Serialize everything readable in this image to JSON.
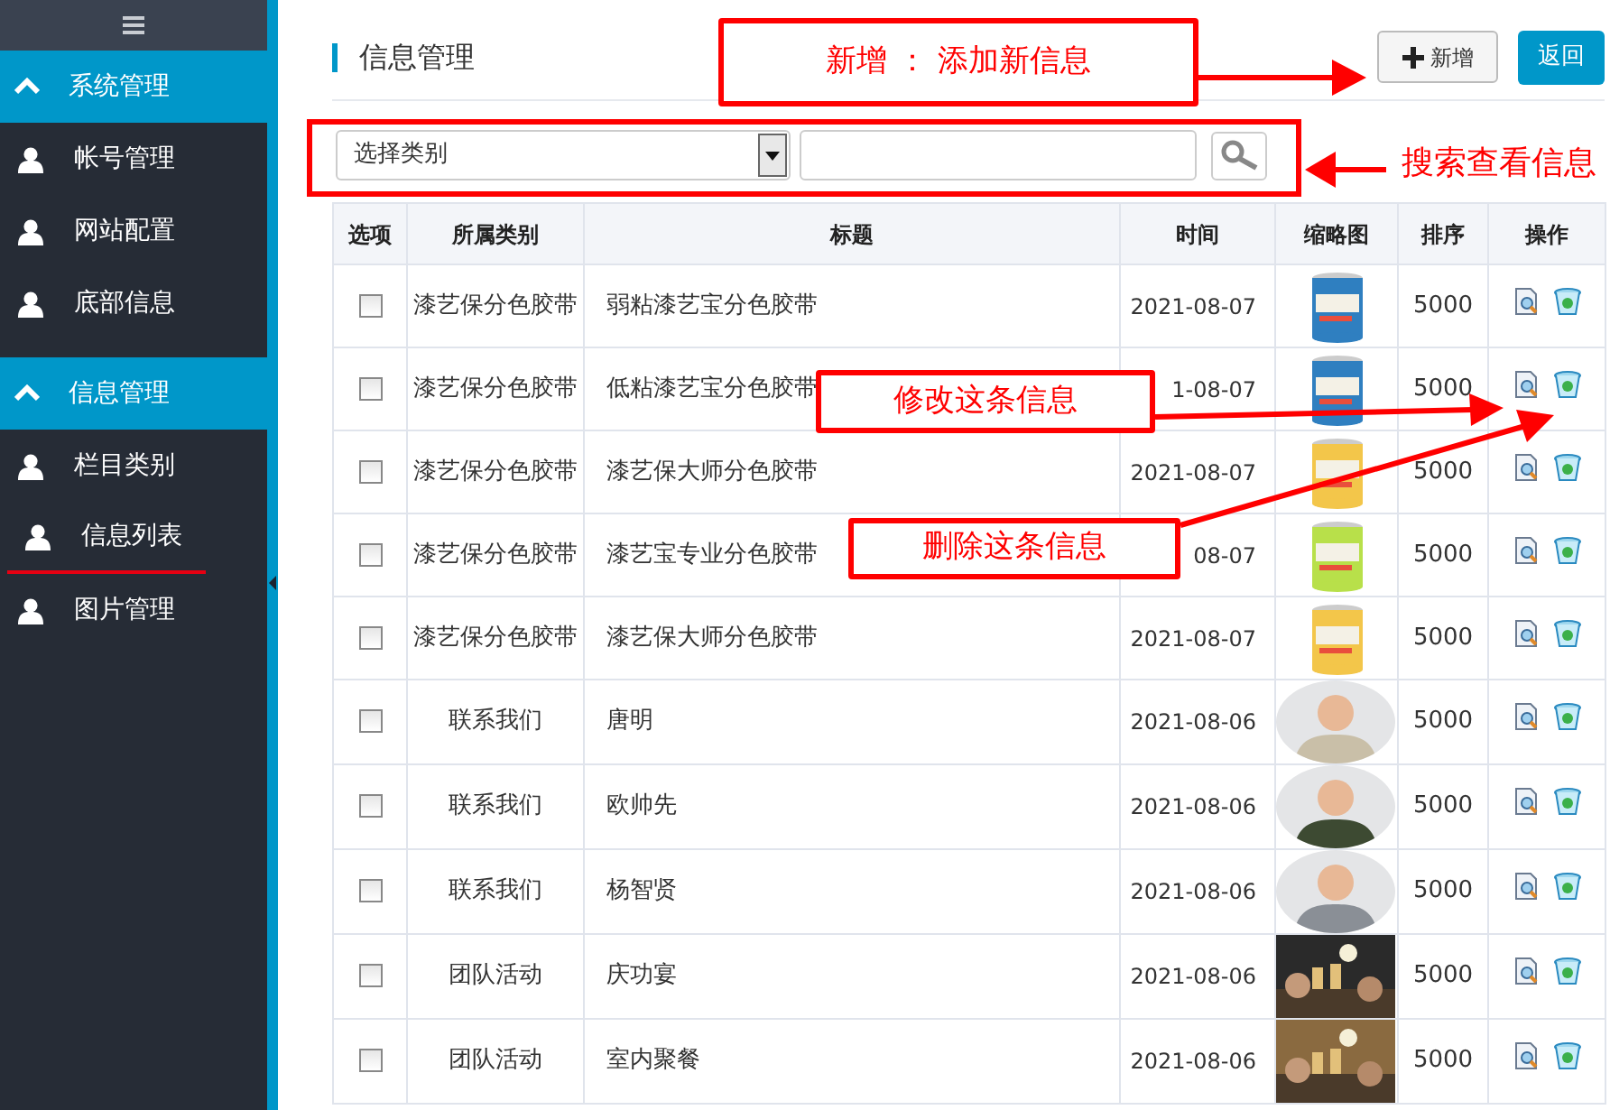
{
  "sidebar": {
    "groups": [
      {
        "title": "系统管理",
        "expanded": true,
        "items": [
          {
            "label": "帐号管理",
            "selected": false
          },
          {
            "label": "网站配置",
            "selected": false
          },
          {
            "label": "底部信息",
            "selected": false
          }
        ]
      },
      {
        "title": "信息管理",
        "expanded": true,
        "items": [
          {
            "label": "栏目类别",
            "selected": false
          },
          {
            "label": "信息列表",
            "selected": true
          },
          {
            "label": "图片管理",
            "selected": false
          }
        ]
      }
    ]
  },
  "page_title": "信息管理",
  "buttons": {
    "add": "新增",
    "back": "返回"
  },
  "filter": {
    "category_select": "选择类别"
  },
  "table": {
    "columns": [
      "选项",
      "所属类别",
      "标题",
      "时间",
      "缩略图",
      "排序",
      "操作"
    ],
    "rows": [
      {
        "checked": false,
        "category": "漆艺保分色胶带",
        "title": "弱粘漆艺宝分色胶带",
        "time": "2021-08-07",
        "sort": "5000"
      },
      {
        "checked": false,
        "category": "漆艺保分色胶带",
        "title": "低粘漆艺宝分色胶带",
        "time": "1-08-07",
        "sort": "5000"
      },
      {
        "checked": false,
        "category": "漆艺保分色胶带",
        "title": "漆艺保大师分色胶带",
        "time": "2021-08-07",
        "sort": "5000"
      },
      {
        "checked": false,
        "category": "漆艺保分色胶带",
        "title": "漆艺宝专业分色胶带",
        "time": "08-07",
        "sort": "5000"
      },
      {
        "checked": false,
        "category": "漆艺保分色胶带",
        "title": "漆艺保大师分色胶带",
        "time": "2021-08-07",
        "sort": "5000"
      },
      {
        "checked": false,
        "category": "联系我们",
        "title": "唐明",
        "time": "2021-08-06",
        "sort": "5000"
      },
      {
        "checked": false,
        "category": "联系我们",
        "title": "欧帅先",
        "time": "2021-08-06",
        "sort": "5000"
      },
      {
        "checked": false,
        "category": "联系我们",
        "title": "杨智贤",
        "time": "2021-08-06",
        "sort": "5000"
      },
      {
        "checked": false,
        "category": "团队活动",
        "title": "庆功宴",
        "time": "2021-08-06",
        "sort": "5000"
      },
      {
        "checked": false,
        "category": "团队活动",
        "title": "室内聚餐",
        "time": "2021-08-06",
        "sort": "5000"
      }
    ]
  },
  "annotations": [
    {
      "text": "新增 ： 添加新信息",
      "kind": "boxed"
    },
    {
      "text": "搜索查看信息",
      "kind": "plain"
    },
    {
      "text": "修改这条信息",
      "kind": "boxed"
    },
    {
      "text": "删除这条信息",
      "kind": "boxed"
    }
  ]
}
